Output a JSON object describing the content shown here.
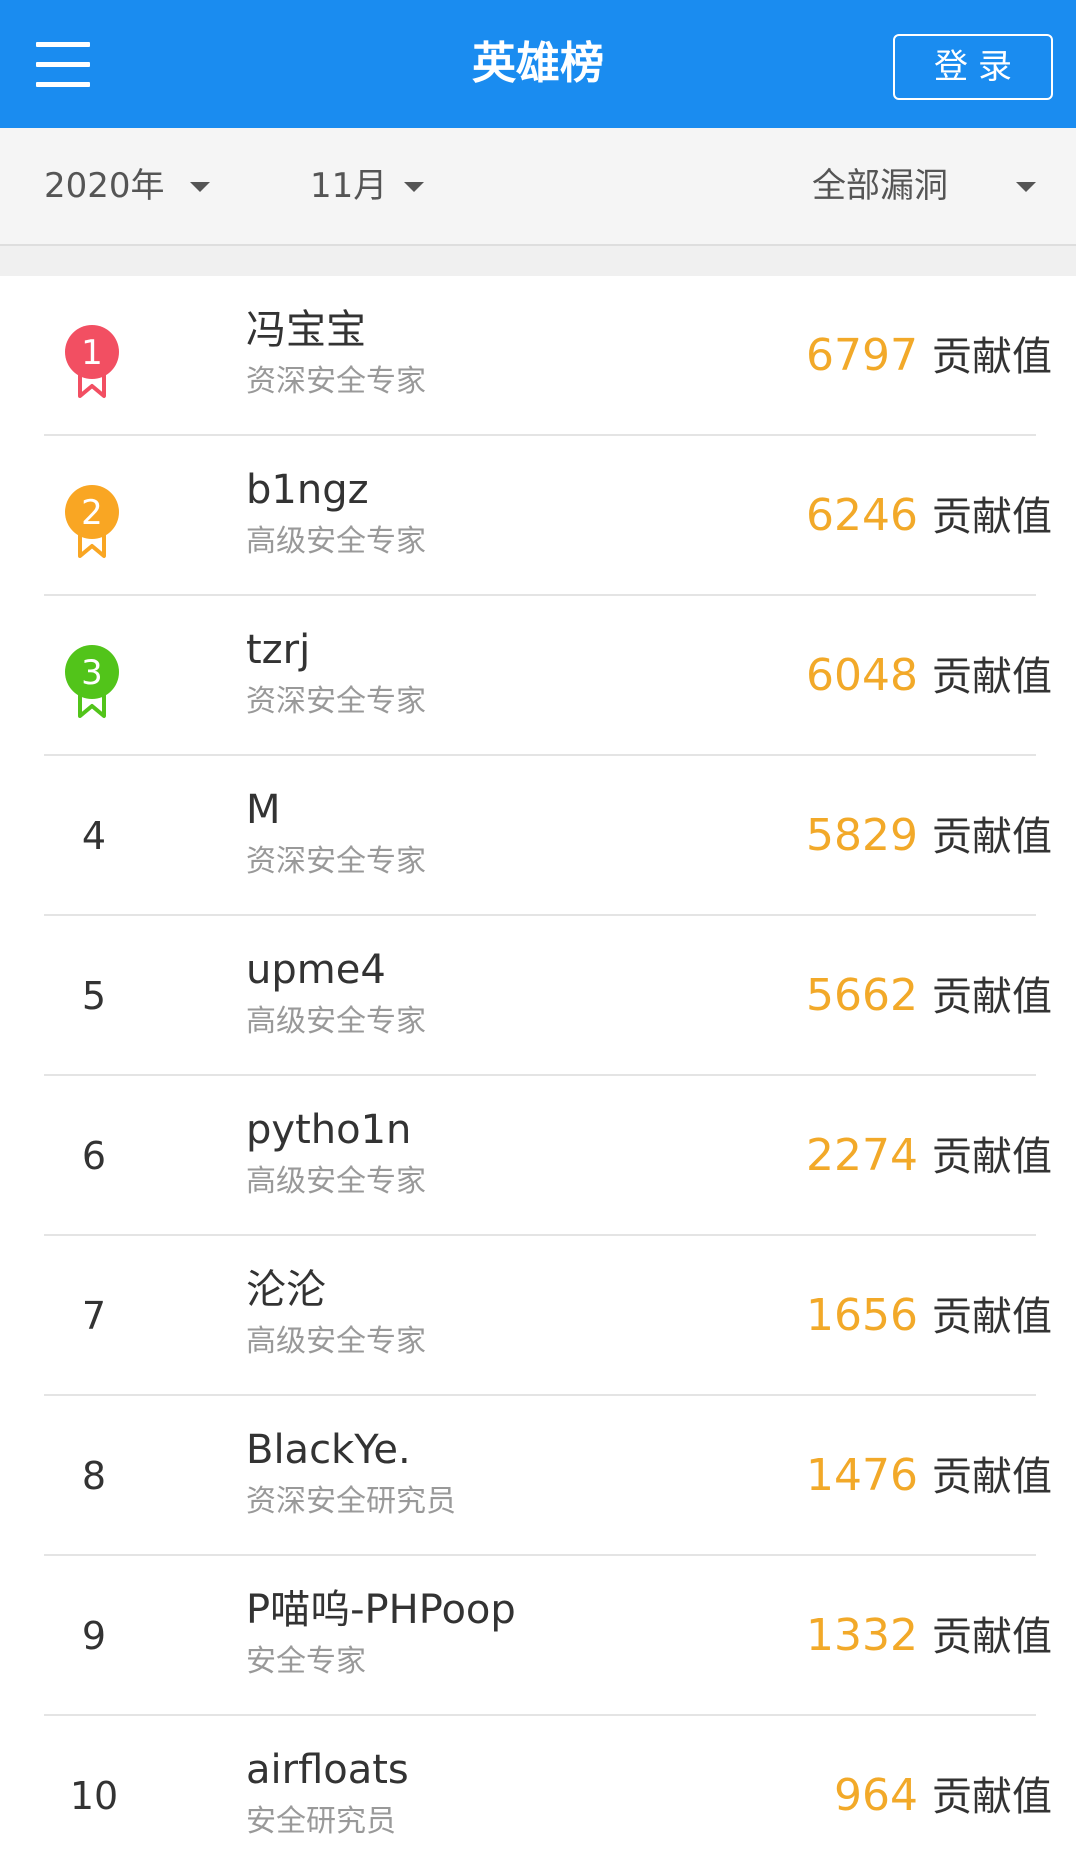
{
  "header": {
    "title": "英雄榜",
    "login_label": "登录"
  },
  "filters": {
    "year": "2020年",
    "month": "11月",
    "type": "全部漏洞"
  },
  "colors": {
    "header_bg": "#1a8cf0",
    "score": "#f2a929",
    "medal_1": "#f24f62",
    "medal_2": "#f9a623",
    "medal_3": "#52c41a"
  },
  "icons": {
    "menu": "hamburger-menu-icon",
    "dropdown": "caret-down-icon",
    "medal": "medal-ribbon-icon"
  },
  "unit_label": "贡献值",
  "rankings": [
    {
      "rank": "1",
      "name": "冯宝宝",
      "title": "资深安全专家",
      "score": "6797"
    },
    {
      "rank": "2",
      "name": "b1ngz",
      "title": "高级安全专家",
      "score": "6246"
    },
    {
      "rank": "3",
      "name": "tzrj",
      "title": "资深安全专家",
      "score": "6048"
    },
    {
      "rank": "4",
      "name": "M",
      "title": "资深安全专家",
      "score": "5829"
    },
    {
      "rank": "5",
      "name": "upme4",
      "title": "高级安全专家",
      "score": "5662"
    },
    {
      "rank": "6",
      "name": "pytho1n",
      "title": "高级安全专家",
      "score": "2274"
    },
    {
      "rank": "7",
      "name": "沦沦",
      "title": "高级安全专家",
      "score": "1656"
    },
    {
      "rank": "8",
      "name": "BlackYe.",
      "title": "资深安全研究员",
      "score": "1476"
    },
    {
      "rank": "9",
      "name": "P喵呜-PHPoop",
      "title": "安全专家",
      "score": "1332"
    },
    {
      "rank": "10",
      "name": "airfloats",
      "title": "安全研究员",
      "score": "964"
    }
  ]
}
